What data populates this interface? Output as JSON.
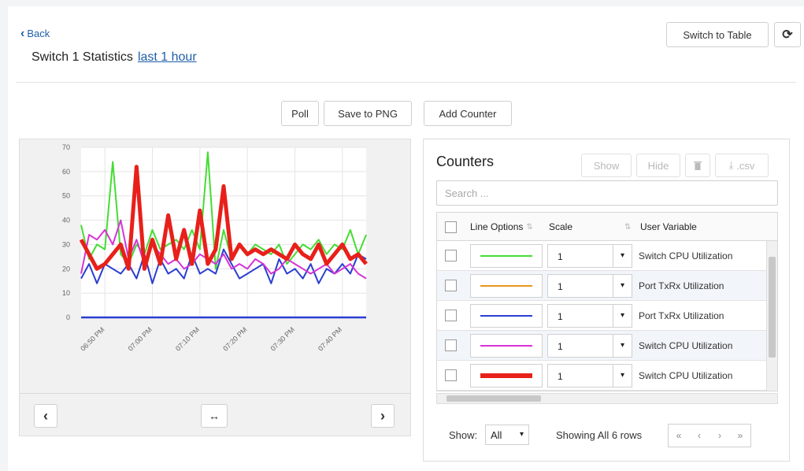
{
  "header": {
    "back_label": "Back",
    "title": "Switch 1 Statistics",
    "period_link": "last 1 hour",
    "switch_to_table": "Switch to Table",
    "refresh_icon": "refresh-icon"
  },
  "toolbar": {
    "poll": "Poll",
    "save_png": "Save to PNG",
    "add_counter": "Add Counter"
  },
  "chart_nav": {
    "prev_icon": "chevron-left-icon",
    "reset_icon": "horizontal-arrows-icon",
    "next_icon": "chevron-right-icon"
  },
  "counters": {
    "title": "Counters",
    "show": "Show",
    "hide": "Hide",
    "delete_icon": "trash-icon",
    "csv": ".csv",
    "search_placeholder": "Search ...",
    "columns": [
      "Line Options",
      "Scale",
      "User Variable"
    ],
    "rows": [
      {
        "color": "#44dd33",
        "thickness": "thin",
        "scale": "1",
        "variable": "Switch CPU Utilization"
      },
      {
        "color": "#e8961c",
        "thickness": "thin",
        "scale": "1",
        "variable": "Port TxRx Utilization"
      },
      {
        "color": "#2a3fd0",
        "thickness": "thin",
        "scale": "1",
        "variable": "Port TxRx Utilization"
      },
      {
        "color": "#d633d6",
        "thickness": "thin",
        "scale": "1",
        "variable": "Switch CPU Utilization"
      },
      {
        "color": "#e8201a",
        "thickness": "thick",
        "scale": "1",
        "variable": "Switch CPU Utilization"
      }
    ],
    "show_label": "Show:",
    "show_value": "All",
    "showing_text": "Showing All 6 rows",
    "pager": [
      "«",
      "‹",
      "›",
      "»"
    ]
  },
  "chart_data": {
    "type": "line",
    "x": [
      "06:50 PM",
      "07:00 PM",
      "07:10 PM",
      "07:20 PM",
      "07:30 PM",
      "07:40 PM"
    ],
    "ylim": [
      0,
      70
    ],
    "yticks": [
      0,
      10,
      20,
      30,
      40,
      50,
      60,
      70
    ],
    "grid": true,
    "series": [
      {
        "color": "#44dd33",
        "width": 2,
        "values": [
          38,
          24,
          30,
          28,
          64,
          26,
          22,
          30,
          26,
          36,
          28,
          30,
          32,
          28,
          36,
          28,
          68,
          20,
          36,
          24,
          30,
          26,
          30,
          28,
          26,
          30,
          22,
          26,
          30,
          28,
          32,
          26,
          30,
          28,
          36,
          26,
          34
        ]
      },
      {
        "color": "#2a3fd0",
        "width": 2,
        "values": [
          16,
          22,
          14,
          22,
          20,
          18,
          22,
          16,
          26,
          14,
          24,
          18,
          20,
          16,
          26,
          18,
          20,
          18,
          28,
          22,
          16,
          18,
          20,
          22,
          14,
          24,
          18,
          20,
          16,
          22,
          14,
          20,
          18,
          22,
          18,
          26,
          24
        ]
      },
      {
        "color": "#d633d6",
        "width": 2,
        "values": [
          18,
          34,
          32,
          36,
          30,
          40,
          24,
          32,
          22,
          30,
          26,
          22,
          24,
          20,
          22,
          26,
          24,
          22,
          26,
          20,
          22,
          20,
          24,
          22,
          18,
          20,
          24,
          22,
          20,
          18,
          20,
          22,
          18,
          20,
          22,
          18,
          16
        ]
      },
      {
        "color": "#e8201a",
        "width": 5,
        "values": [
          32,
          26,
          20,
          22,
          26,
          30,
          20,
          62,
          20,
          32,
          22,
          42,
          24,
          36,
          22,
          44,
          22,
          28,
          54,
          24,
          30,
          26,
          28,
          26,
          28,
          26,
          24,
          30,
          26,
          24,
          30,
          22,
          26,
          30,
          24,
          26,
          22
        ]
      },
      {
        "color": "#2a3fd0",
        "width": 2.5,
        "values": [
          0,
          0
        ]
      }
    ]
  }
}
